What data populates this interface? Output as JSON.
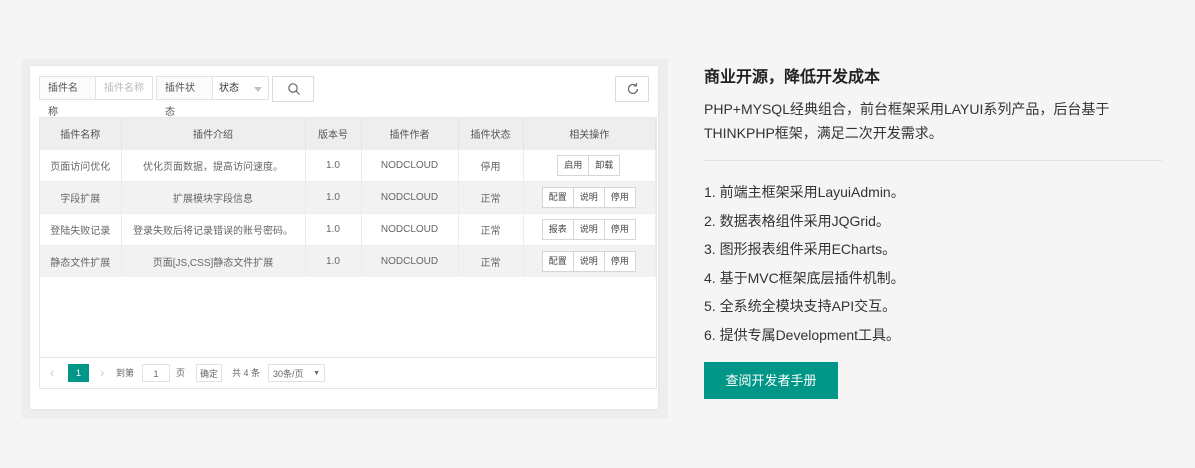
{
  "colors": {
    "accent": "#009688",
    "background": "#f5f5f5"
  },
  "toolbar": {
    "plugin_name_label": "插件名称",
    "plugin_name_placeholder": "插件名称",
    "status_label": "插件状态",
    "status_value": "状态",
    "search_icon": "search-icon",
    "refresh_icon": "refresh-icon"
  },
  "table": {
    "headers": [
      "插件名称",
      "插件介绍",
      "版本号",
      "插件作者",
      "插件状态",
      "相关操作"
    ],
    "rows": [
      {
        "name": "页面访问优化",
        "intro": "优化页面数据，提高访问速度。",
        "version": "1.0",
        "author": "NODCLOUD",
        "status": "停用",
        "ops": [
          "启用",
          "卸载"
        ]
      },
      {
        "name": "字段扩展",
        "intro": "扩展模块字段信息",
        "version": "1.0",
        "author": "NODCLOUD",
        "status": "正常",
        "ops": [
          "配置",
          "说明",
          "停用"
        ]
      },
      {
        "name": "登陆失败记录",
        "intro": "登录失败后将记录错误的账号密码。",
        "version": "1.0",
        "author": "NODCLOUD",
        "status": "正常",
        "ops": [
          "报表",
          "说明",
          "停用"
        ]
      },
      {
        "name": "静态文件扩展",
        "intro": "页面[JS,CSS]静态文件扩展",
        "version": "1.0",
        "author": "NODCLOUD",
        "status": "正常",
        "ops": [
          "配置",
          "说明",
          "停用"
        ]
      }
    ]
  },
  "pager": {
    "current_page": "1",
    "goto_prefix": "到第",
    "goto_value": "1",
    "goto_suffix": "页",
    "confirm": "确定",
    "total": "共 4 条",
    "page_size": "30条/页"
  },
  "right": {
    "heading": "商业开源，降低开发成本",
    "description": "PHP+MYSQL经典组合，前台框架采用LAYUI系列产品，后台基于THINKPHP框架，满足二次开发需求。",
    "features": [
      "1. 前端主框架采用LayuiAdmin。",
      "2. 数据表格组件采用JQGrid。",
      "3. 图形报表组件采用ECharts。",
      "4. 基于MVC框架底层插件机制。",
      "5. 全系统全模块支持API交互。",
      "6. 提供专属Development工具。"
    ],
    "button_label": "查阅开发者手册"
  }
}
